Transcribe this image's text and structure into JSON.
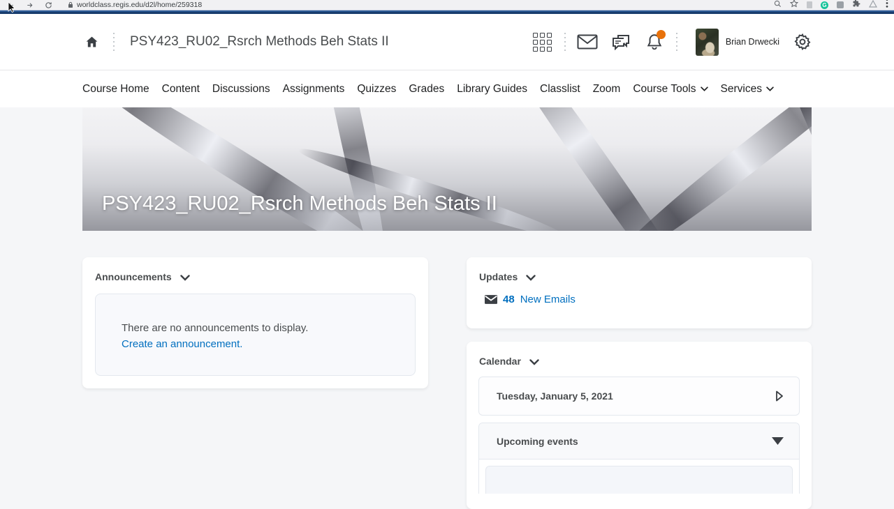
{
  "browser": {
    "url": "worldclass.regis.edu/d2l/home/259318"
  },
  "header": {
    "course_title": "PSY423_RU02_Rsrch Methods Beh Stats II",
    "user_name": "Brian Drwecki"
  },
  "nav": {
    "items": [
      {
        "label": "Course Home"
      },
      {
        "label": "Content"
      },
      {
        "label": "Discussions"
      },
      {
        "label": "Assignments"
      },
      {
        "label": "Quizzes"
      },
      {
        "label": "Grades"
      },
      {
        "label": "Library Guides"
      },
      {
        "label": "Classlist"
      },
      {
        "label": "Zoom"
      },
      {
        "label": "Course Tools"
      },
      {
        "label": "Services"
      }
    ]
  },
  "banner": {
    "title": "PSY423_RU02_Rsrch Methods Beh Stats II"
  },
  "widgets": {
    "announcements": {
      "title": "Announcements",
      "empty_message": "There are no announcements to display.",
      "create_link": "Create an announcement."
    },
    "updates": {
      "title": "Updates",
      "email_count": "48",
      "email_label": "New Emails"
    },
    "calendar": {
      "title": "Calendar",
      "date": "Tuesday, January 5, 2021",
      "upcoming_label": "Upcoming events"
    }
  },
  "colors": {
    "link_blue": "#006fbf",
    "heading_gray": "#494c4e",
    "notification_orange": "#e8710a",
    "band_blue": "#2e5b96"
  }
}
